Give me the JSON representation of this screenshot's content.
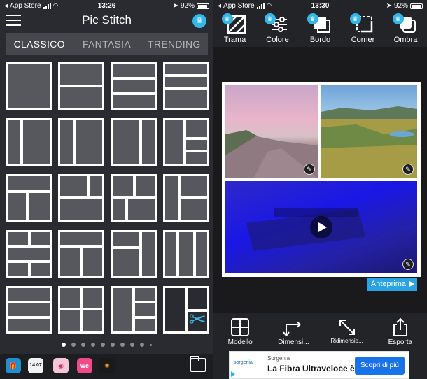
{
  "left": {
    "status": {
      "carrier": "App Store",
      "time": "13:26",
      "battery": "92%",
      "battery_level": 0.92
    },
    "header": {
      "title": "Pic Stitch"
    },
    "tabs": [
      {
        "label": "CLASSICO",
        "active": true
      },
      {
        "label": "FANTASIA",
        "active": false
      },
      {
        "label": "TRENDING",
        "active": false
      }
    ],
    "pager": {
      "count": 10,
      "active": 0
    },
    "bottom_apps": [
      "photo-stitch-gift-icon",
      "calendar-app-icon",
      "camera-app-icon",
      "we-heart-it-app-icon",
      "fireworks-app-icon"
    ],
    "calendar_badge": "14.07",
    "weheart_badge": "we"
  },
  "right": {
    "status": {
      "carrier": "App Store",
      "time": "13:30",
      "battery": "92%",
      "battery_level": 0.92
    },
    "toolbar": [
      {
        "name": "trama",
        "label": "Trama"
      },
      {
        "name": "colore",
        "label": "Colore"
      },
      {
        "name": "bordo",
        "label": "Bordo"
      },
      {
        "name": "corner",
        "label": "Corner"
      },
      {
        "name": "ombra",
        "label": "Ombra"
      }
    ],
    "preview_label": "Anteprima",
    "bottom_tools": [
      {
        "name": "modello",
        "label": "Modello"
      },
      {
        "name": "dimensioni",
        "label": "Dimensi..."
      },
      {
        "name": "ridimensiona",
        "label": "Ridimensio..."
      },
      {
        "name": "esporta",
        "label": "Esporta"
      }
    ],
    "ad": {
      "logo": "sorgenia",
      "brand": "Sorgenia",
      "headline": "La Fibra Ultraveloce è qui",
      "cta": "Scopri di più"
    }
  },
  "colors": {
    "accent": "#34b6e8",
    "preview": "#29a3e3",
    "ad_cta": "#1a72e8"
  }
}
